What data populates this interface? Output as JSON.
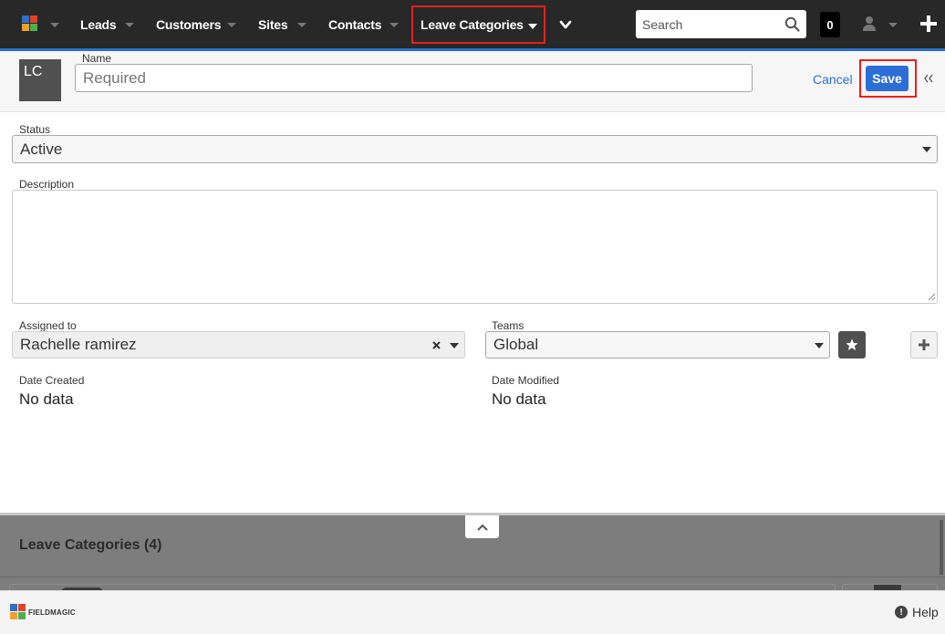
{
  "nav": {
    "items": [
      {
        "label": "Leads"
      },
      {
        "label": "Customers"
      },
      {
        "label": "Sites"
      },
      {
        "label": "Contacts"
      }
    ],
    "active_item": "Leave Categories",
    "search_placeholder": "Search",
    "notifications_count": "0"
  },
  "record": {
    "avatar_initials": "LC",
    "name_label": "Name",
    "name_placeholder": "Required",
    "cancel_label": "Cancel",
    "save_label": "Save"
  },
  "form": {
    "status_label": "Status",
    "status_value": "Active",
    "description_label": "Description",
    "description_value": "",
    "assigned_label": "Assigned to",
    "assigned_value": "Rachelle ramirez",
    "teams_label": "Teams",
    "teams_value": "Global",
    "date_created_label": "Date Created",
    "date_created_value": "No data",
    "date_modified_label": "Date Modified",
    "date_modified_value": "No data"
  },
  "bottom_panel": {
    "title": "Leave Categories (4)"
  },
  "footer": {
    "brand": "FIELDMAGIC",
    "help_label": "Help"
  },
  "colors": {
    "topnav_bg": "#282828",
    "accent": "#2b6fd6",
    "highlight": "#e8211a",
    "logo_blue": "#2f6fc4",
    "logo_red": "#e0412a",
    "logo_green": "#4caf50",
    "logo_orange": "#f0a030"
  }
}
